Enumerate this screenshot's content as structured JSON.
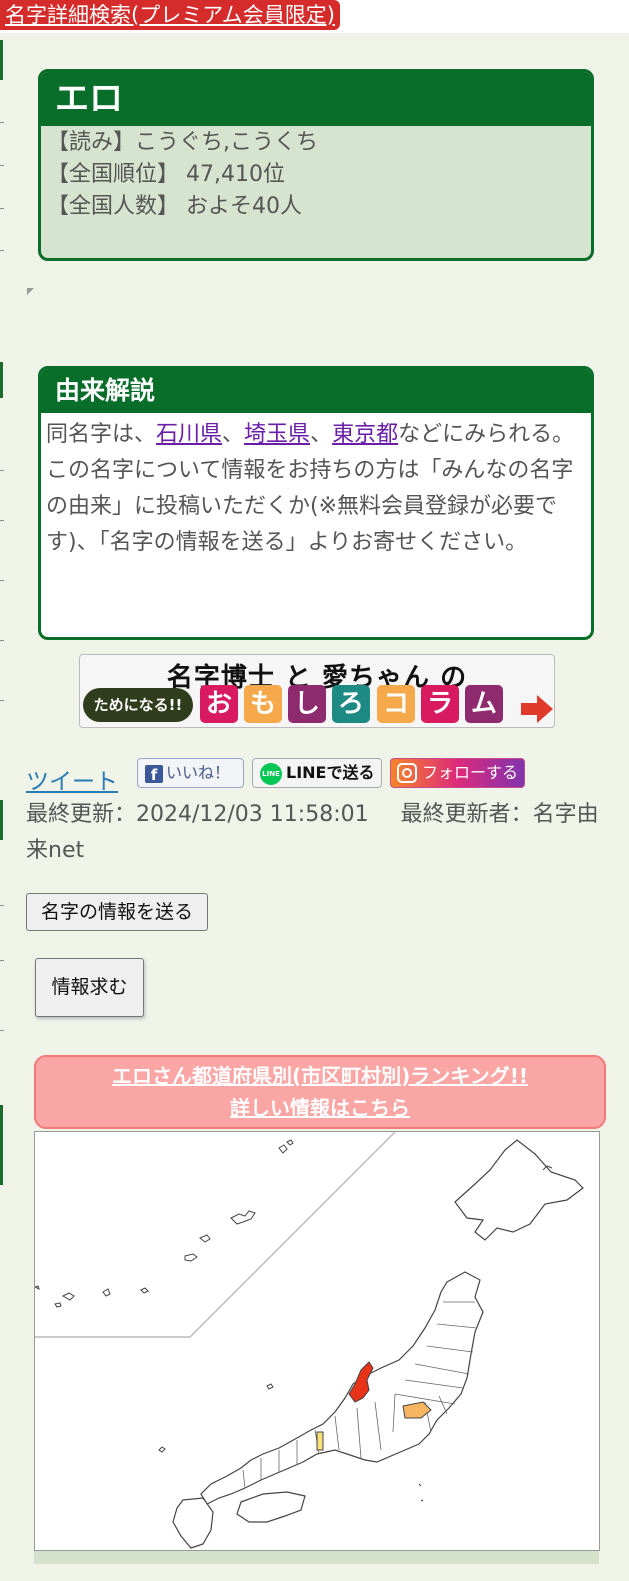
{
  "top": {
    "advanced_search_link": "名字詳細検索(プレミアム会員限定)"
  },
  "name_box": {
    "title": "エロ",
    "reading": "【読み】こうぐち,こうくち",
    "rank": "【全国順位】 47,410位",
    "population": "【全国人数】 およそ40人"
  },
  "origin": {
    "heading": "由来解説",
    "text_before": "同名字は、",
    "places": [
      "石川県",
      "埼玉県",
      "東京都"
    ],
    "separator": "、",
    "text_after": "などにみられる。",
    "paragraph2": "この名字について情報をお持ちの方は「みんなの名字の由来」に投稿いただくか(※無料会員登録が必要です)、「名字の情報を送る」よりお寄せください。"
  },
  "banner": {
    "title": "名字博士 と 愛ちゃん の",
    "pill": "ためになる!!",
    "tiles": [
      "お",
      "も",
      "し",
      "ろ",
      "コ",
      "ラ",
      "ム"
    ],
    "tile_colors": [
      "#d81b60",
      "#f6a94a",
      "#8e2a6e",
      "#1e8a84",
      "#f6a94a",
      "#d81b60",
      "#8e2a6e"
    ],
    "arrow_color": "#e03a2a"
  },
  "share": {
    "tweet": "ツイート",
    "like": "いいね！",
    "line": "LINEで送る",
    "line_icon_text": "LINE",
    "instagram": "フォローする"
  },
  "update": {
    "last_updated": "最終更新：2024/12/03 11:58:01",
    "updated_by": "最終更新者：名字由来net"
  },
  "buttons": {
    "send_info": "名字の情報を送る",
    "request_info": "情報求む"
  },
  "ranking": {
    "line1": "エロさん都道府県別(市区町村別)ランキング!!",
    "line2": "詳しい情報はこちら"
  },
  "colors": {
    "brand_green": "#0a6e2b",
    "map_red": "#e8321a",
    "map_orange": "#f7b562",
    "map_yellow": "#f7e07a"
  }
}
